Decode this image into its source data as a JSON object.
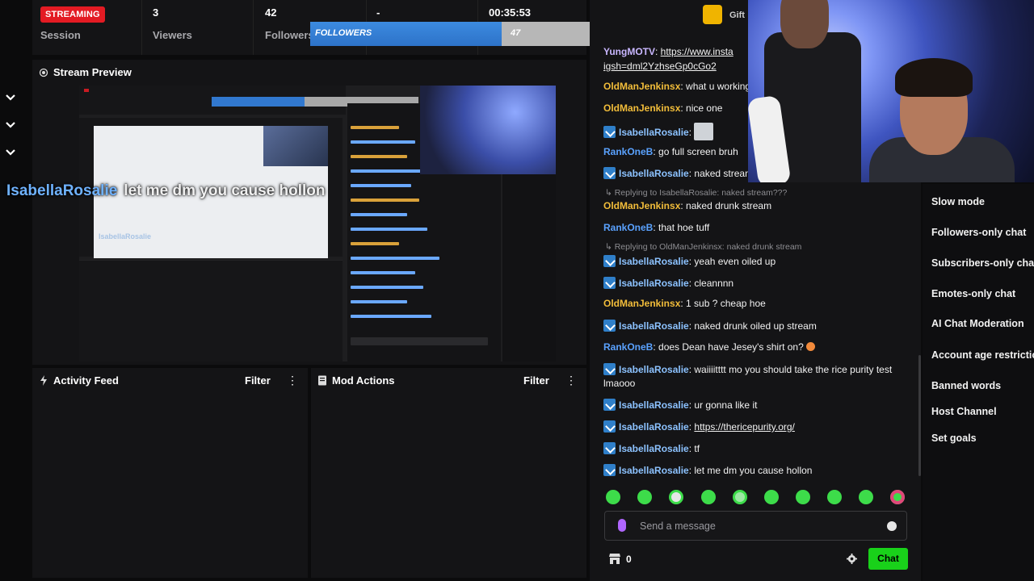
{
  "header": {
    "live_badge": "STREAMING",
    "session_label": "Session",
    "viewers_value": "3",
    "viewers_label": "Viewers",
    "followers_value": "42",
    "followers_label": "Followers",
    "dash_value": "-",
    "timer": "00:35:53"
  },
  "goal": {
    "label": "FOLLOWERS",
    "current": "47",
    "max": "100",
    "progress": 0.47
  },
  "preview": {
    "title": "Stream Preview",
    "caption_name": "IsabellaRosalie",
    "caption_text": "let me dm you cause hollon"
  },
  "activity_feed": {
    "title": "Activity Feed",
    "filter": "Filter"
  },
  "mod_actions": {
    "title": "Mod Actions",
    "filter": "Filter"
  },
  "gift": {
    "label": "Gift"
  },
  "chat": {
    "top_partial": {
      "name": "YungMOTV",
      "link_part1": "https://www.insta",
      "link_part2": "igsh=dml2YzhseGp0cGo2"
    },
    "messages": [
      {
        "user": "OldManJenkinsx",
        "text": "what u working"
      },
      {
        "user": "OldManJenkinsx",
        "text": "nice one"
      },
      {
        "user": "IsabellaRosalie",
        "text": ""
      },
      {
        "user": "RankOneB",
        "text": "go full screen bruh"
      },
      {
        "user": "IsabellaRosalie",
        "text": "naked stream"
      },
      {
        "reply": "Replying to IsabellaRosalie: naked stream???"
      },
      {
        "user": "OldManJenkinsx",
        "text": "naked drunk stream"
      },
      {
        "user": "RankOneB",
        "text": "that hoe tuff"
      },
      {
        "reply": "Replying to OldManJenkinsx: naked drunk stream"
      },
      {
        "user": "IsabellaRosalie",
        "text": "yeah even oiled up"
      },
      {
        "user": "IsabellaRosalie",
        "text": "cleannnn"
      },
      {
        "user": "OldManJenkinsx",
        "text": "1 sub ? cheap hoe"
      },
      {
        "user": "IsabellaRosalie",
        "text": "naked drunk oiled up stream"
      },
      {
        "user": "RankOneB",
        "text": "does Dean have Jesey's shirt on?"
      },
      {
        "user": "IsabellaRosalie",
        "text": "waiiiitttt mo you should take the rice purity test"
      },
      {
        "cont": "lmaooo"
      },
      {
        "user": "IsabellaRosalie",
        "text": "ur gonna like it"
      },
      {
        "user": "IsabellaRosalie",
        "text": "https://thericepurity.org/"
      },
      {
        "user": "IsabellaRosalie",
        "text": "tf"
      },
      {
        "user": "IsabellaRosalie",
        "text": "let me dm you cause hollon"
      }
    ],
    "input_placeholder": "Send a message",
    "points": "0",
    "chat_button": "Chat"
  },
  "settings_menu": [
    "Slow mode",
    "Followers-only chat",
    "Subscribers-only chat",
    "Emotes-only chat",
    "AI Chat Moderation",
    "Account age restriction",
    "Banned words",
    "Host Channel",
    "Set goals"
  ],
  "colors": {
    "live_red": "#e31b23",
    "goal_blue": "#2d72c8",
    "chat_green": "#19d11a",
    "name_gold": "#f2bd3a",
    "name_blue": "#8cc2ff"
  }
}
